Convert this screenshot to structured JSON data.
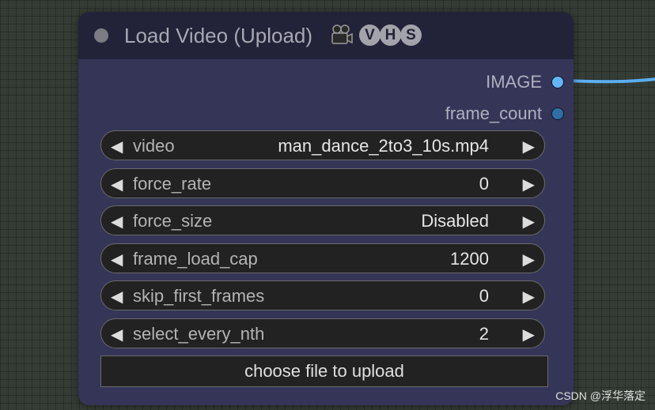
{
  "node": {
    "title": "Load Video (Upload)",
    "badges": [
      "V",
      "H",
      "S"
    ],
    "icon": "video-camera-icon",
    "outputs": [
      {
        "label": "IMAGE",
        "color": "#64b5f6"
      },
      {
        "label": "frame_count",
        "color": "#2f6fa5"
      }
    ],
    "widgets": [
      {
        "label": "video",
        "value": "man_dance_2to3_10s.mp4"
      },
      {
        "label": "force_rate",
        "value": "0"
      },
      {
        "label": "force_size",
        "value": "Disabled"
      },
      {
        "label": "frame_load_cap",
        "value": "1200"
      },
      {
        "label": "skip_first_frames",
        "value": "0"
      },
      {
        "label": "select_every_nth",
        "value": "2"
      }
    ],
    "upload_button": "choose file to upload",
    "arrow_left": "◀",
    "arrow_right": "▶"
  },
  "watermark": "CSDN @浮华落定",
  "colors": {
    "canvas": "#353c35",
    "node_body": "#353558",
    "node_header": "#222238",
    "link": "#64b5f6"
  }
}
